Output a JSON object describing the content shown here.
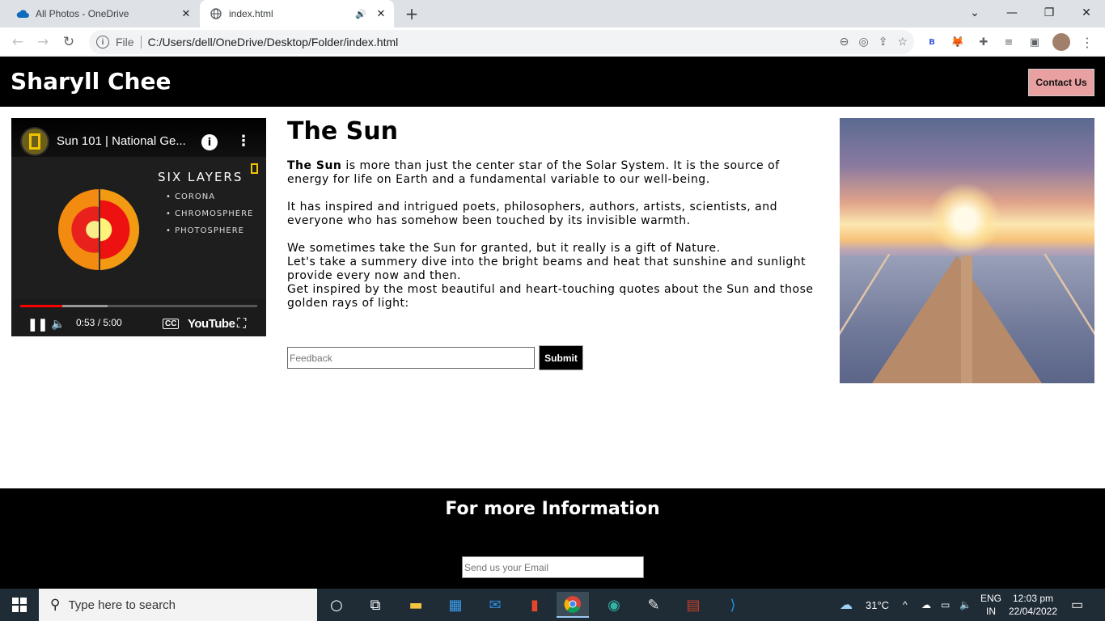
{
  "browser": {
    "tabs": [
      {
        "title": "All Photos - OneDrive",
        "active": false
      },
      {
        "title": "index.html",
        "active": true
      }
    ],
    "address": {
      "scheme": "File",
      "path": "C:/Users/dell/OneDrive/Desktop/Folder/index.html"
    },
    "extension_b_label": "B"
  },
  "site": {
    "title": "Sharyll Chee",
    "contact_label": "Contact Us"
  },
  "video": {
    "title": "Sun 101 | National Ge...",
    "slide_heading": "SIX LAYERS",
    "slide_items": [
      "• CORONA",
      "• CHROMOSPHERE",
      "• PHOTOSPHERE"
    ],
    "time": "0:53 / 5:00",
    "progress": 0.177,
    "buffered": 0.37,
    "brand": "YouTube"
  },
  "article": {
    "heading": "The Sun",
    "p1_bold": "The Sun",
    "p1_rest": " is more than just the center star of the Solar System. It is the source of energy for life on Earth and a fundamental variable to our well-being.",
    "p2": "It has inspired and intrigued poets, philosophers, authors, artists, scientists, and everyone who has somehow been touched by its invisible warmth.",
    "p3_line1": "We sometimes take the Sun for granted, but it really is a gift of Nature.",
    "p3_line2": "Let's take a summery dive into the bright beams and heat that sunshine and sunlight provide every now and then.",
    "p3_line3": "Get inspired by the most beautiful and heart-touching quotes about the Sun and those golden rays of light:"
  },
  "feedback": {
    "placeholder": "Feedback",
    "submit_label": "Submit"
  },
  "footer": {
    "title": "For more Information",
    "email_placeholder": "Send us your Email"
  },
  "taskbar": {
    "search_placeholder": "Type here to search",
    "weather": "31°C",
    "lang_top": "ENG",
    "lang_bottom": "IN",
    "time": "12:03 pm",
    "date": "22/04/2022"
  }
}
